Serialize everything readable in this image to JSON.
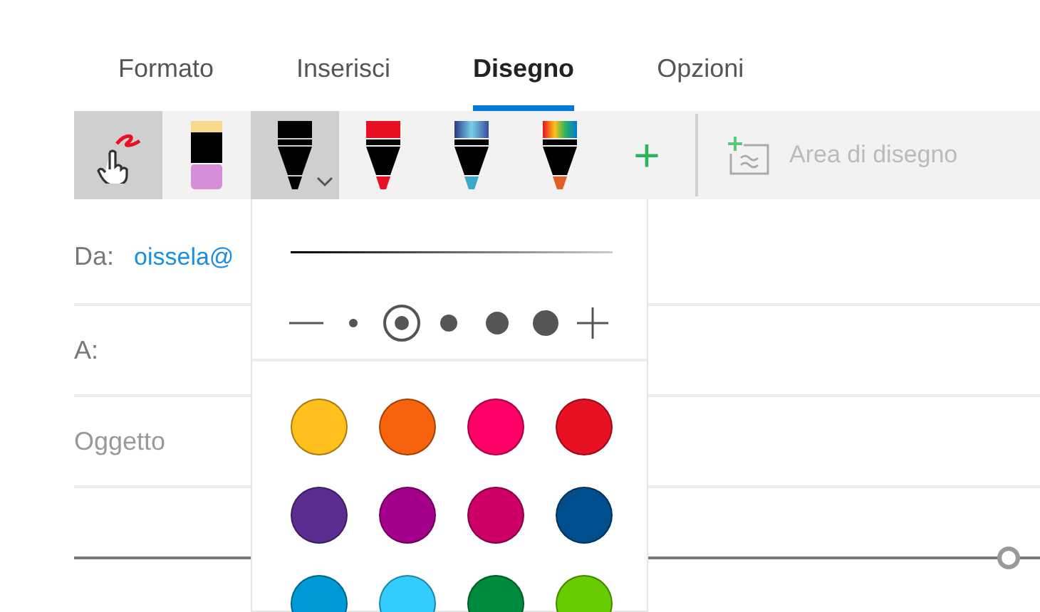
{
  "tabs": [
    {
      "label": "Formato",
      "selected": false
    },
    {
      "label": "Inserisci",
      "selected": false
    },
    {
      "label": "Disegno",
      "selected": true
    },
    {
      "label": "Opzioni",
      "selected": false
    }
  ],
  "toolbar": {
    "touch_draw": {
      "selected": true
    },
    "tools": [
      {
        "kind": "highlighter",
        "color": "#d48fd8",
        "selected": false
      },
      {
        "kind": "pen",
        "color": "#000000",
        "selected": true
      },
      {
        "kind": "pen",
        "color": "#e81123",
        "selected": false
      },
      {
        "kind": "galaxy",
        "selected": false
      },
      {
        "kind": "rainbow",
        "selected": false
      }
    ],
    "add_label": "+",
    "canvas_button": {
      "label": "Area di disegno",
      "disabled": true
    }
  },
  "mail": {
    "from_label": "Da:",
    "from_value": "oissela@",
    "to_label": "A:",
    "subject_placeholder": "Oggetto"
  },
  "pen_menu": {
    "sizes": [
      {
        "selected": false
      },
      {
        "selected": true
      },
      {
        "selected": false
      },
      {
        "selected": false
      },
      {
        "selected": false
      }
    ],
    "colors": [
      {
        "color": "#ffc01e",
        "selected": false
      },
      {
        "color": "#f7630c",
        "selected": false
      },
      {
        "color": "#ff0066",
        "selected": false
      },
      {
        "color": "#e81123",
        "selected": false
      },
      {
        "color": "#5c2d91",
        "selected": false
      },
      {
        "color": "#a4008c",
        "selected": false
      },
      {
        "color": "#cc0066",
        "selected": false
      },
      {
        "color": "#004e8c",
        "selected": false
      },
      {
        "color": "#0099d8",
        "selected": false
      },
      {
        "color": "#33ccff",
        "selected": false
      },
      {
        "color": "#008a3e",
        "selected": false
      },
      {
        "color": "#66cc00",
        "selected": false
      }
    ]
  }
}
